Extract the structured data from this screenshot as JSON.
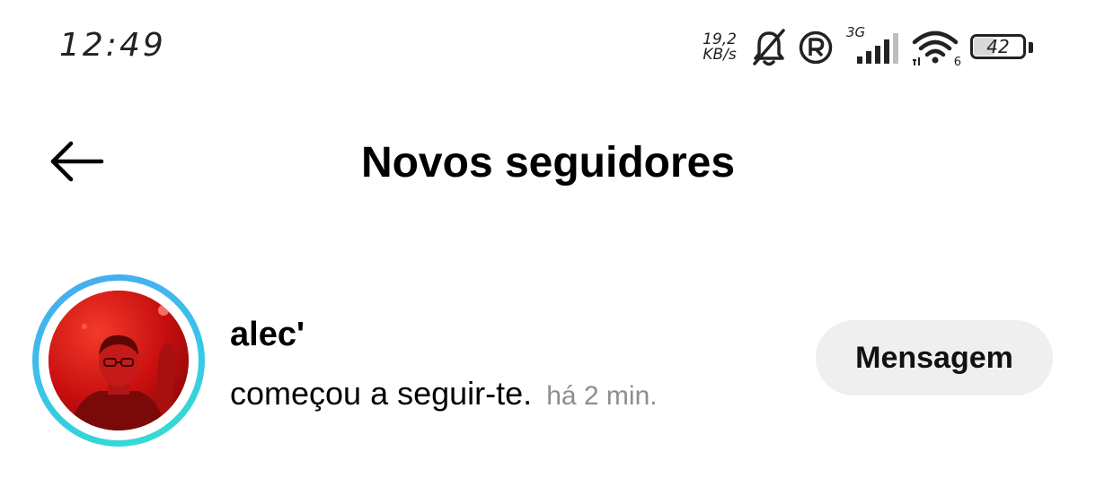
{
  "status_bar": {
    "time": "12:49",
    "net_speed_value": "19,2",
    "net_speed_unit": "KB/s",
    "network_type": "3G",
    "wifi_label": "6",
    "battery_percent": "42",
    "battery_level": 0.42,
    "icons": [
      "bell-muted-icon",
      "registered-r-icon",
      "signal-bars-icon",
      "wifi-icon",
      "battery-icon"
    ]
  },
  "header": {
    "back_icon": "arrow-left-icon",
    "title": "Novos seguidores"
  },
  "notifications": [
    {
      "username": "alec'",
      "activity": "começou a seguir-te.",
      "time_ago": "há 2 min.",
      "action_label": "Mensagem"
    }
  ],
  "colors": {
    "story_ring_start": "#4aa8f0",
    "story_ring_end": "#33e0cf",
    "button_bg": "#efefef",
    "timestamp": "#8e8e8e"
  }
}
